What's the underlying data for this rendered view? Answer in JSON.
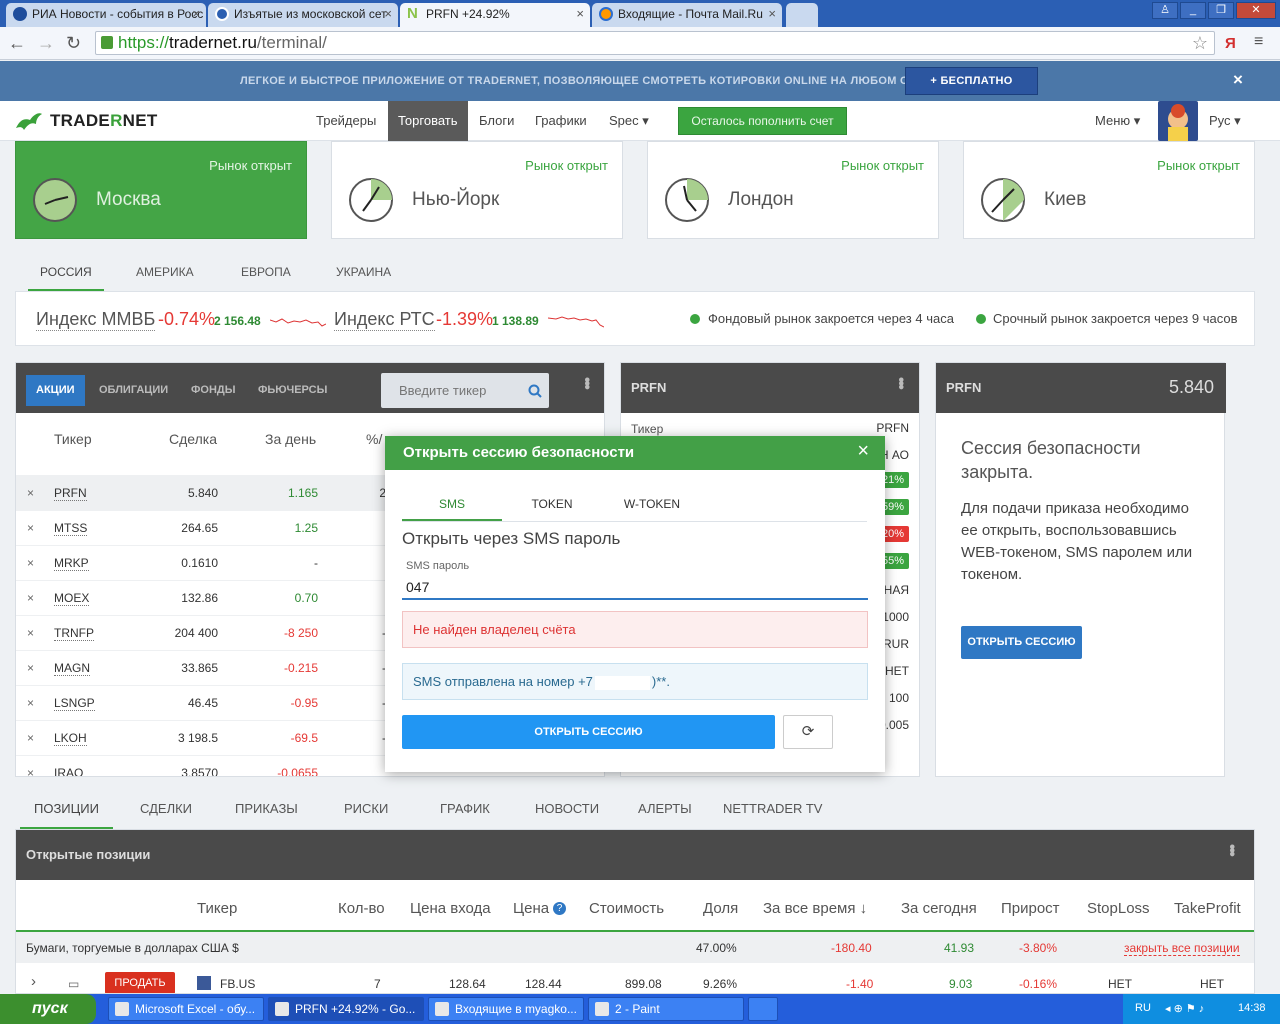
{
  "browser": {
    "tabs": [
      {
        "title": "РИА Новости - события в Росс",
        "icon": "ria-icon"
      },
      {
        "title": "Изъятые из московской сет",
        "icon": "rss-icon"
      },
      {
        "title": "PRFN +24.92%",
        "icon": "tradernet-n-icon"
      },
      {
        "title": "Входящие - Почта Mail.Ru",
        "icon": "mail-ru-icon"
      }
    ],
    "url_scheme": "https://",
    "url_host": "tradernet.ru",
    "url_path": "/terminal/"
  },
  "promo": {
    "text": "ЛЕГКОЕ И БЫСТРОЕ ПРИЛОЖЕНИЕ ОТ TRADERNET, ПОЗВОЛЯЮЩЕЕ СМОТРЕТЬ КОТИРОВКИ ONLINE НА ЛЮБОМ САЙТЕ",
    "button": "+ БЕСПЛАТНО",
    "close": "×"
  },
  "header": {
    "logo_a": "TRADE",
    "logo_b": "R",
    "logo_c": "NET",
    "nav": [
      "Трейдеры",
      "Торговать",
      "Блоги",
      "Графики",
      "Spec ▾"
    ],
    "topup": "Осталось пополнить счет",
    "menu": "Меню ▾",
    "lang": "Рус ▾"
  },
  "markets": [
    {
      "city": "Москва",
      "status": "Рынок открыт"
    },
    {
      "city": "Нью-Йорк",
      "status": "Рынок открыт"
    },
    {
      "city": "Лондон",
      "status": "Рынок открыт"
    },
    {
      "city": "Киев",
      "status": "Рынок открыт"
    }
  ],
  "regions": [
    "РОССИЯ",
    "АМЕРИКА",
    "ЕВРОПА",
    "УКРАИНА"
  ],
  "indices": [
    {
      "name": "Индекс ММВБ",
      "change": "-0.74%",
      "value": "2 156.48"
    },
    {
      "name": "Индекс РТС",
      "change": "-1.39%",
      "value": "1 138.89"
    }
  ],
  "market_status": [
    "Фондовый рынок закроется через 4 часа",
    "Срочный рынок закроется через 9 часов"
  ],
  "quotes": {
    "tabs": [
      "АКЦИИ",
      "ОБЛИГАЦИИ",
      "ФОНДЫ",
      "ФЬЮЧЕРСЫ"
    ],
    "search_placeholder": "Введите тикер",
    "columns": [
      "Тикер",
      "Сделка",
      "За день",
      "%/"
    ],
    "rows": [
      {
        "ticker": "PRFN",
        "price": "5.840",
        "change": "1.165",
        "pct": "2",
        "dir": "pos",
        "hl": true
      },
      {
        "ticker": "MTSS",
        "price": "264.65",
        "change": "1.25",
        "pct": "",
        "dir": "pos",
        "hl": false
      },
      {
        "ticker": "MRKP",
        "price": "0.1610",
        "change": "-",
        "pct": "",
        "dir": "",
        "hl": false
      },
      {
        "ticker": "MOEX",
        "price": "132.86",
        "change": "0.70",
        "pct": "",
        "dir": "pos",
        "hl": false
      },
      {
        "ticker": "TRNFP",
        "price": "204 400",
        "change": "-8 250",
        "pct": "-",
        "dir": "neg",
        "hl": false
      },
      {
        "ticker": "MAGN",
        "price": "33.865",
        "change": "-0.215",
        "pct": "-",
        "dir": "neg",
        "hl": false
      },
      {
        "ticker": "LSNGP",
        "price": "46.45",
        "change": "-0.95",
        "pct": "-",
        "dir": "neg",
        "hl": false
      },
      {
        "ticker": "LKOH",
        "price": "3 198.5",
        "change": "-69.5",
        "pct": "-",
        "dir": "neg",
        "hl": false
      },
      {
        "ticker": "IRAO",
        "price": "3.8570",
        "change": "-0.0655",
        "pct": "",
        "dir": "neg",
        "hl": false
      }
    ]
  },
  "detail": {
    "title": "PRFN",
    "rows": [
      {
        "label": "Тикер",
        "value": "PRFN",
        "badge": ""
      },
      {
        "label": "",
        "value": "Н АО",
        "badge": ""
      },
      {
        "label": "",
        "value": "21%",
        "badge": "pos"
      },
      {
        "label": "",
        "value": "59%",
        "badge": "pos"
      },
      {
        "label": "",
        "value": "20%",
        "badge": "neg"
      },
      {
        "label": "",
        "value": "55%",
        "badge": "pos"
      },
      {
        "label": "",
        "value": "НАЯ",
        "badge": ""
      },
      {
        "label": "",
        "value": "1000",
        "badge": ""
      },
      {
        "label": "",
        "value": "RUR",
        "badge": ""
      },
      {
        "label": "",
        "value": "НЕТ",
        "badge": ""
      },
      {
        "label": "",
        "value": "100",
        "badge": ""
      },
      {
        "label": "",
        "value": "0.005",
        "badge": ""
      }
    ]
  },
  "session_panel": {
    "ticker": "PRFN",
    "price": "5.840",
    "heading": "Сессия безопасности закрыта.",
    "text": "Для подачи приказа необходимо ее открыть, воспользовавшись WEB-токеном, SMS паролем или токеном.",
    "button": "ОТКРЫТЬ СЕССИЮ"
  },
  "modal": {
    "title": "Открыть сессию безопасности",
    "close": "×",
    "tabs": [
      "SMS",
      "TOKEN",
      "W-TOKEN"
    ],
    "subtitle": "Открыть через SMS пароль",
    "field_label": "SMS пароль",
    "field_value": "047",
    "error": "Не найден владелец счёта",
    "info_prefix": "SMS отправлена на номер +7",
    "info_suffix": ")**.",
    "submit": "ОТКРЫТЬ СЕССИЮ",
    "refresh_icon": "refresh-icon"
  },
  "bottom_tabs": [
    "ПОЗИЦИИ",
    "СДЕЛКИ",
    "ПРИКАЗЫ",
    "РИСКИ",
    "ГРАФИК",
    "НОВОСТИ",
    "АЛЕРТЫ",
    "NETTRADER TV"
  ],
  "positions": {
    "title": "Открытые позиции",
    "columns": [
      "Тикер",
      "Кол-во",
      "Цена входа",
      "Цена",
      "Стоимость",
      "Доля",
      "За все время ↓",
      "За сегодня",
      "Прирост",
      "StopLoss",
      "TakeProfit"
    ],
    "group": {
      "label": "Бумаги, торгуемые в долларах США $",
      "share": "47.00%",
      "alltime": "-180.40",
      "today": "41.93",
      "growth": "-3.80%",
      "close_all": "закрыть все позиции"
    },
    "row": {
      "sell": "ПРОДАТЬ",
      "ticker": "FB.US",
      "qty": "7",
      "entry": "128.64",
      "price": "128.44",
      "cost": "899.08",
      "share": "9.26%",
      "alltime": "-1.40",
      "today": "9.03",
      "growth": "-0.16%",
      "stoploss": "НЕТ",
      "takeprofit": "НЕТ"
    }
  },
  "taskbar": {
    "start": "пуск",
    "items": [
      {
        "title": "Microsoft Excel - обу...",
        "active": false
      },
      {
        "title": "PRFN +24.92% - Go...",
        "active": true
      },
      {
        "title": "Входящие в myagko...",
        "active": false
      },
      {
        "title": "2 - Paint",
        "active": false
      }
    ],
    "lang": "RU",
    "time": "14:38"
  },
  "colors": {
    "green": "#3ba540",
    "red": "#e53935",
    "blue": "#2f78c4",
    "dark_bar": "#4a4a4a"
  }
}
